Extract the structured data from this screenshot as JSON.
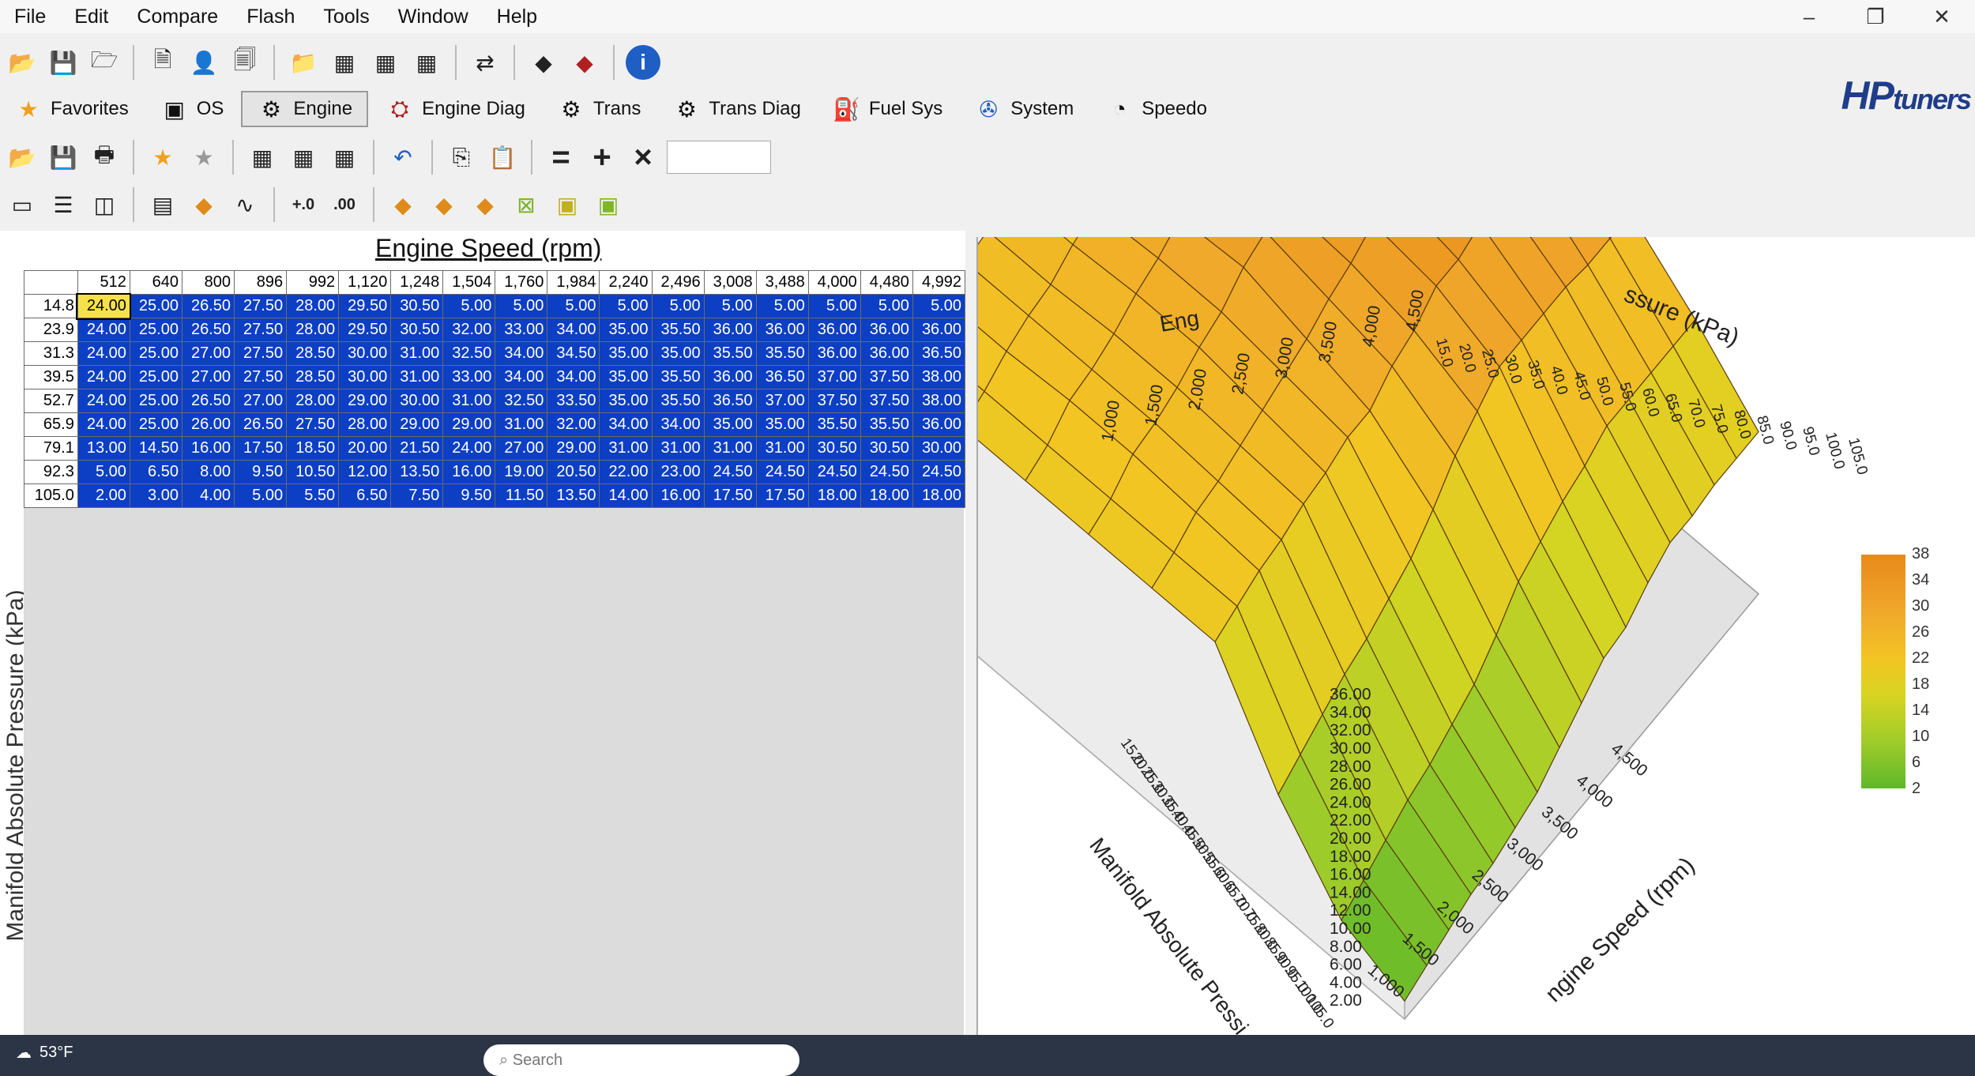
{
  "menu": [
    "File",
    "Edit",
    "Compare",
    "Flash",
    "Tools",
    "Window",
    "Help"
  ],
  "window_controls": [
    "–",
    "❐",
    "✕"
  ],
  "brand": {
    "main": "HP",
    "suffix": "tuners"
  },
  "nav_tabs": [
    {
      "label": "Favorites",
      "icon": "star-icon"
    },
    {
      "label": "OS",
      "icon": "chip-icon"
    },
    {
      "label": "Engine",
      "icon": "engine-icon",
      "active": true
    },
    {
      "label": "Engine Diag",
      "icon": "engine-diag-icon"
    },
    {
      "label": "Trans",
      "icon": "gear-icon"
    },
    {
      "label": "Trans Diag",
      "icon": "trans-diag-icon"
    },
    {
      "label": "Fuel Sys",
      "icon": "fuel-pump-icon"
    },
    {
      "label": "System",
      "icon": "fan-icon"
    },
    {
      "label": "Speedo",
      "icon": "speedometer-icon"
    }
  ],
  "table": {
    "x_title": "Engine Speed (rpm)",
    "y_title": "Manifold Absolute Pressure (kPa)",
    "columns": [
      "512",
      "640",
      "800",
      "896",
      "992",
      "1,120",
      "1,248",
      "1,504",
      "1,760",
      "1,984",
      "2,240",
      "2,496",
      "3,008",
      "3,488",
      "4,000",
      "4,480",
      "4,992"
    ],
    "rows": [
      {
        "h": "14.8",
        "v": [
          "24.00",
          "25.00",
          "26.50",
          "27.50",
          "28.00",
          "29.50",
          "30.50",
          "5.00",
          "5.00",
          "5.00",
          "5.00",
          "5.00",
          "5.00",
          "5.00",
          "5.00",
          "5.00",
          "5.00"
        ]
      },
      {
        "h": "23.9",
        "v": [
          "24.00",
          "25.00",
          "26.50",
          "27.50",
          "28.00",
          "29.50",
          "30.50",
          "32.00",
          "33.00",
          "34.00",
          "35.00",
          "35.50",
          "36.00",
          "36.00",
          "36.00",
          "36.00",
          "36.00"
        ]
      },
      {
        "h": "31.3",
        "v": [
          "24.00",
          "25.00",
          "27.00",
          "27.50",
          "28.50",
          "30.00",
          "31.00",
          "32.50",
          "34.00",
          "34.50",
          "35.00",
          "35.00",
          "35.50",
          "35.50",
          "36.00",
          "36.00",
          "36.50"
        ]
      },
      {
        "h": "39.5",
        "v": [
          "24.00",
          "25.00",
          "27.00",
          "27.50",
          "28.50",
          "30.00",
          "31.00",
          "33.00",
          "34.00",
          "34.00",
          "35.00",
          "35.50",
          "36.00",
          "36.50",
          "37.00",
          "37.50",
          "38.00"
        ]
      },
      {
        "h": "52.7",
        "v": [
          "24.00",
          "25.00",
          "26.50",
          "27.00",
          "28.00",
          "29.00",
          "30.00",
          "31.00",
          "32.50",
          "33.50",
          "35.00",
          "35.50",
          "36.50",
          "37.00",
          "37.50",
          "37.50",
          "38.00"
        ]
      },
      {
        "h": "65.9",
        "v": [
          "24.00",
          "25.00",
          "26.00",
          "26.50",
          "27.50",
          "28.00",
          "29.00",
          "29.00",
          "31.00",
          "32.00",
          "34.00",
          "34.00",
          "35.00",
          "35.00",
          "35.50",
          "35.50",
          "36.00"
        ]
      },
      {
        "h": "79.1",
        "v": [
          "13.00",
          "14.50",
          "16.00",
          "17.50",
          "18.50",
          "20.00",
          "21.50",
          "24.00",
          "27.00",
          "29.00",
          "31.00",
          "31.00",
          "31.00",
          "31.00",
          "30.50",
          "30.50",
          "30.00"
        ]
      },
      {
        "h": "92.3",
        "v": [
          "5.00",
          "6.50",
          "8.00",
          "9.50",
          "10.50",
          "12.00",
          "13.50",
          "16.00",
          "19.00",
          "20.50",
          "22.00",
          "23.00",
          "24.50",
          "24.50",
          "24.50",
          "24.50",
          "24.50"
        ]
      },
      {
        "h": "105.0",
        "v": [
          "2.00",
          "3.00",
          "4.00",
          "5.00",
          "5.50",
          "6.50",
          "7.50",
          "9.50",
          "11.50",
          "13.50",
          "14.00",
          "16.00",
          "17.50",
          "17.50",
          "18.00",
          "18.00",
          "18.00"
        ]
      }
    ]
  },
  "chart3d": {
    "rpm_axis_label": "Engine Speed (rpm)",
    "map_axis_label": "Manifold Absolute Pressure (kPa)",
    "top_rpm_label": "Eng",
    "top_map_label": "ssure (kPa)",
    "bottom_map_label": "Manifold Absolute Pressi",
    "bottom_rpm_label": "ngine Speed (rpm)",
    "z_ticks": [
      "36.00",
      "34.00",
      "32.00",
      "30.00",
      "28.00",
      "26.00",
      "24.00",
      "22.00",
      "20.00",
      "18.00",
      "16.00",
      "14.00",
      "12.00",
      "10.00",
      "8.00",
      "6.00",
      "4.00",
      "2.00"
    ],
    "rpm_ticks_top": [
      "1,000",
      "1,500",
      "2,000",
      "2,500",
      "3,000",
      "3,500",
      "4,000",
      "4,500"
    ],
    "map_ticks": [
      "15.0",
      "20.0",
      "25.0",
      "30.0",
      "35.0",
      "40.0",
      "45.0",
      "50.0",
      "55.0",
      "60.0",
      "65.0",
      "70.0",
      "75.0",
      "80.0",
      "85.0",
      "90.0",
      "95.0",
      "100.0",
      "105.0"
    ],
    "rpm_ticks_bottom": [
      "4,500",
      "4,000",
      "3,500",
      "3,000",
      "2,500",
      "2,000",
      "1,500",
      "1,000"
    ],
    "legend": [
      "38",
      "34",
      "30",
      "26",
      "22",
      "18",
      "14",
      "10",
      "6",
      "2"
    ]
  },
  "taskbar": {
    "weather": "53°F",
    "search": "Search"
  }
}
